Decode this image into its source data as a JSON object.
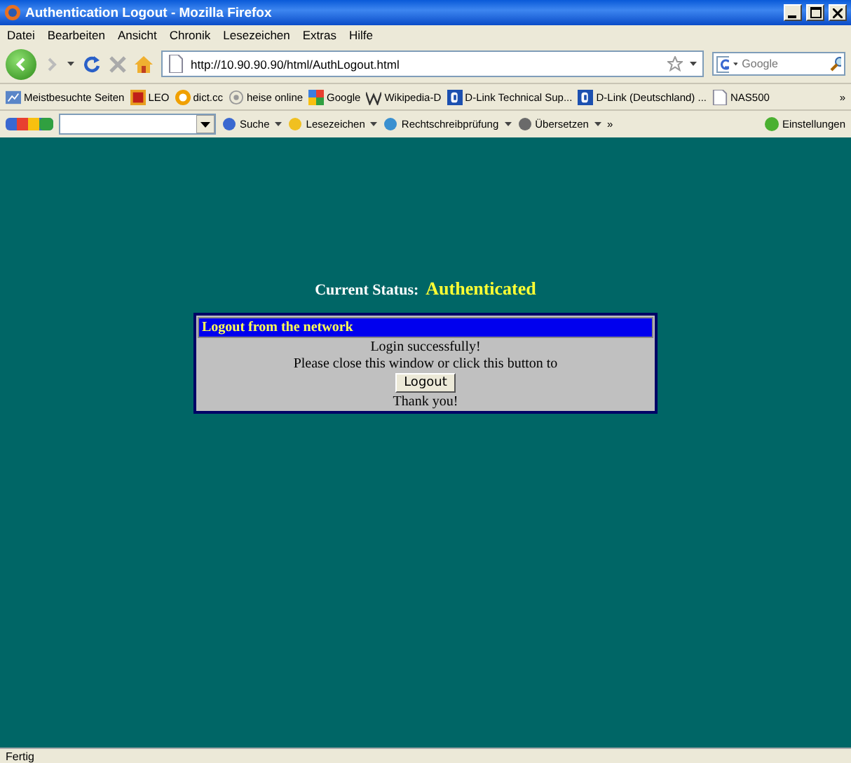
{
  "window": {
    "title": "Authentication Logout - Mozilla Firefox"
  },
  "menu": [
    "Datei",
    "Bearbeiten",
    "Ansicht",
    "Chronik",
    "Lesezeichen",
    "Extras",
    "Hilfe"
  ],
  "navigation": {
    "url": "http://10.90.90.90/html/AuthLogout.html",
    "search": {
      "placeholder": "Google"
    }
  },
  "bookmarks": [
    {
      "label": "Meistbesuchte Seiten",
      "kind": "chart"
    },
    {
      "label": "LEO",
      "kind": "leo"
    },
    {
      "label": "dict.cc",
      "kind": "dict"
    },
    {
      "label": "heise online",
      "kind": "heise"
    },
    {
      "label": "Google",
      "kind": "google"
    },
    {
      "label": "Wikipedia-D",
      "kind": "wiki"
    },
    {
      "label": "D-Link Technical Sup...",
      "kind": "dlink"
    },
    {
      "label": "D-Link (Deutschland) ...",
      "kind": "dlink"
    },
    {
      "label": "NAS500",
      "kind": "page"
    }
  ],
  "bookmarks_overflow": "»",
  "google_toolbar": {
    "items": [
      "Suche",
      "Lesezeichen",
      "Rechtschreibprüfung",
      "Übersetzen"
    ],
    "overflow": "»",
    "settings": "Einstellungen"
  },
  "page": {
    "status_label": "Current Status:",
    "status_value": "Authenticated",
    "panel": {
      "title": "Logout from the network",
      "lines": [
        "Login successfully!",
        "Please close this window or click this button to"
      ],
      "button": "Logout",
      "footer": "Thank you!"
    }
  },
  "status_bar": "Fertig"
}
